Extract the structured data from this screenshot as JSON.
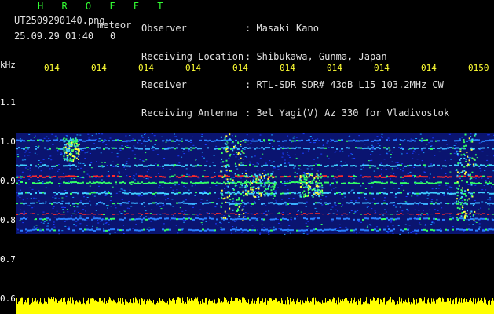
{
  "header": {
    "title": "H R O F F T",
    "filename": "UT2509290140.png",
    "mode": "meteor",
    "datetime": "25.09.29 01:40",
    "small_value": "0",
    "labels": [
      "Observer",
      "Receiving Location",
      "Receiver",
      "Receiving Antenna"
    ],
    "values": [
      ": Masaki Kano",
      ": Shibukawa, Gunma, Japan",
      ": RTL-SDR SDR# 43dB L15 103.2MHz CW",
      ": 3el Yagi(V) Az 330 for Vladivostok"
    ]
  },
  "axis": {
    "y_unit": "kHz",
    "y_ticks": [
      "1.1",
      "1.0",
      "0.9",
      "0.8",
      "0.7",
      "0.6"
    ],
    "x_ticks": [
      "014",
      "014",
      "014",
      "014",
      "014",
      "014",
      "014",
      "014",
      "014",
      "0150"
    ]
  },
  "colors": {
    "background": "#000000",
    "title": "#33ff33",
    "ticks": "#ffff33",
    "noise_floor": "#ffff00",
    "signal_hot": "#ff2a2a",
    "signal_mid": "#33ff66",
    "signal_base": "#1a3cff"
  }
}
